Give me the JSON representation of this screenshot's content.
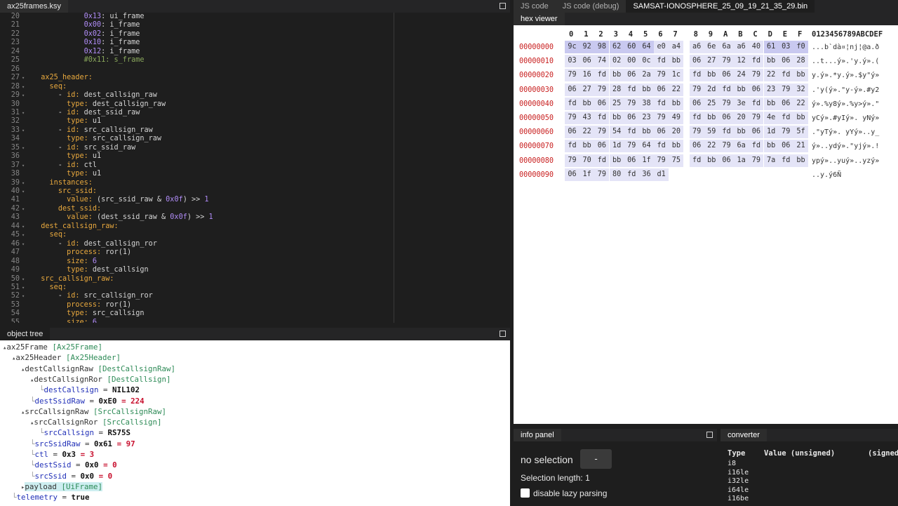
{
  "editor": {
    "tab": "ax25frames.ksy",
    "lines": [
      {
        "n": "20",
        "fold": false,
        "html": "            <span class='n'>0x13</span><span class='s'>: ui_frame</span>"
      },
      {
        "n": "21",
        "fold": false,
        "html": "            <span class='n'>0x00</span><span class='s'>: i_frame</span>"
      },
      {
        "n": "22",
        "fold": false,
        "html": "            <span class='n'>0x02</span><span class='s'>: i_frame</span>"
      },
      {
        "n": "23",
        "fold": false,
        "html": "            <span class='n'>0x10</span><span class='s'>: i_frame</span>"
      },
      {
        "n": "24",
        "fold": false,
        "html": "            <span class='n'>0x12</span><span class='s'>: i_frame</span>"
      },
      {
        "n": "25",
        "fold": false,
        "html": "            <span class='c'>#0x11: s_frame</span>"
      },
      {
        "n": "26",
        "fold": false,
        "html": ""
      },
      {
        "n": "27",
        "fold": true,
        "html": "  <span class='k'>ax25_header:</span>"
      },
      {
        "n": "28",
        "fold": true,
        "html": "    <span class='k'>seq:</span>"
      },
      {
        "n": "29",
        "fold": true,
        "html": "      - <span class='k'>id:</span> dest_callsign_raw"
      },
      {
        "n": "30",
        "fold": false,
        "html": "        <span class='k'>type:</span> dest_callsign_raw"
      },
      {
        "n": "31",
        "fold": true,
        "html": "      - <span class='k'>id:</span> dest_ssid_raw"
      },
      {
        "n": "32",
        "fold": false,
        "html": "        <span class='k'>type:</span> u1"
      },
      {
        "n": "33",
        "fold": true,
        "html": "      - <span class='k'>id:</span> src_callsign_raw"
      },
      {
        "n": "34",
        "fold": false,
        "html": "        <span class='k'>type:</span> src_callsign_raw"
      },
      {
        "n": "35",
        "fold": true,
        "html": "      - <span class='k'>id:</span> src_ssid_raw"
      },
      {
        "n": "36",
        "fold": false,
        "html": "        <span class='k'>type:</span> u1"
      },
      {
        "n": "37",
        "fold": true,
        "html": "      - <span class='k'>id:</span> ctl"
      },
      {
        "n": "38",
        "fold": false,
        "html": "        <span class='k'>type:</span> u1"
      },
      {
        "n": "39",
        "fold": true,
        "html": "    <span class='k'>instances:</span>"
      },
      {
        "n": "40",
        "fold": true,
        "html": "      <span class='k'>src_ssid:</span>"
      },
      {
        "n": "41",
        "fold": false,
        "html": "        <span class='k'>value:</span> (src_ssid_raw &amp; <span class='n'>0x0f</span>) &gt;&gt; <span class='n'>1</span>"
      },
      {
        "n": "42",
        "fold": true,
        "html": "      <span class='k'>dest_ssid:</span>"
      },
      {
        "n": "43",
        "fold": false,
        "html": "        <span class='k'>value:</span> (dest_ssid_raw &amp; <span class='n'>0x0f</span>) &gt;&gt; <span class='n'>1</span>"
      },
      {
        "n": "44",
        "fold": true,
        "html": "  <span class='k'>dest_callsign_raw:</span>"
      },
      {
        "n": "45",
        "fold": true,
        "html": "    <span class='k'>seq:</span>"
      },
      {
        "n": "46",
        "fold": true,
        "html": "      - <span class='k'>id:</span> dest_callsign_ror"
      },
      {
        "n": "47",
        "fold": false,
        "html": "        <span class='k'>process:</span> ror(1)"
      },
      {
        "n": "48",
        "fold": false,
        "html": "        <span class='k'>size:</span> <span class='n'>6</span>"
      },
      {
        "n": "49",
        "fold": false,
        "html": "        <span class='k'>type:</span> dest_callsign"
      },
      {
        "n": "50",
        "fold": true,
        "html": "  <span class='k'>src_callsign_raw:</span>"
      },
      {
        "n": "51",
        "fold": true,
        "html": "    <span class='k'>seq:</span>"
      },
      {
        "n": "52",
        "fold": true,
        "html": "      - <span class='k'>id:</span> src_callsign_ror"
      },
      {
        "n": "53",
        "fold": false,
        "html": "        <span class='k'>process:</span> ror(1)"
      },
      {
        "n": "54",
        "fold": false,
        "html": "        <span class='k'>type:</span> src_callsign"
      },
      {
        "n": "55",
        "fold": false,
        "html": "        <span class='k'>size:</span> <span class='n'>6</span>"
      }
    ]
  },
  "tree": {
    "title": "object tree",
    "nodes": [
      {
        "depth": 0,
        "name": "ax25Frame",
        "type": "[Ax25Frame]",
        "expander": "▴"
      },
      {
        "depth": 1,
        "name": "ax25Header",
        "type": "[Ax25Header]",
        "expander": "▴"
      },
      {
        "depth": 2,
        "name": "destCallsignRaw",
        "type": "[DestCallsignRaw]",
        "expander": "▴"
      },
      {
        "depth": 3,
        "name": "destCallsignRor",
        "type": "[DestCallsign]",
        "expander": "▴"
      },
      {
        "depth": 4,
        "field": "destCallsign",
        "value": "NIL102"
      },
      {
        "depth": 3,
        "field": "destSsidRaw",
        "value": "0xE0",
        "dec": "224"
      },
      {
        "depth": 2,
        "name": "srcCallsignRaw",
        "type": "[SrcCallsignRaw]",
        "expander": "▴"
      },
      {
        "depth": 3,
        "name": "srcCallsignRor",
        "type": "[SrcCallsign]",
        "expander": "▴"
      },
      {
        "depth": 4,
        "field": "srcCallsign",
        "value": "RS75S"
      },
      {
        "depth": 3,
        "field": "srcSsidRaw",
        "value": "0x61",
        "dec": "97"
      },
      {
        "depth": 3,
        "field": "ctl",
        "value": "0x3",
        "dec": "3"
      },
      {
        "depth": 3,
        "field": "destSsid",
        "value": "0x0",
        "dec": "0"
      },
      {
        "depth": 3,
        "field": "srcSsid",
        "value": "0x0",
        "dec": "0"
      },
      {
        "depth": 2,
        "name": "payload",
        "type": "[UiFrame]",
        "expander": "▸",
        "selected": true
      },
      {
        "depth": 1,
        "field": "telemetry",
        "value": "true"
      }
    ]
  },
  "right_tabs": [
    "JS code",
    "JS code (debug)",
    "SAMSAT-IONOSPHERE_25_09_19_21_35_29.bin"
  ],
  "hex": {
    "title": "hex viewer",
    "columns": [
      "0",
      "1",
      "2",
      "3",
      "4",
      "5",
      "6",
      "7",
      "8",
      "9",
      "A",
      "B",
      "C",
      "D",
      "E",
      "F"
    ],
    "ascii_header": "0123456789ABCDEF",
    "rows": [
      {
        "addr": "00000000",
        "bytes": [
          "9c",
          "92",
          "98",
          "62",
          "60",
          "64",
          "e0",
          "a4",
          "a6",
          "6e",
          "6a",
          "a6",
          "40",
          "61",
          "03",
          "f0"
        ],
        "ascii": "...b`dà¤¦nj¦@a.ð"
      },
      {
        "addr": "00000010",
        "bytes": [
          "03",
          "06",
          "74",
          "02",
          "00",
          "0c",
          "fd",
          "bb",
          "06",
          "27",
          "79",
          "12",
          "fd",
          "bb",
          "06",
          "28"
        ],
        "ascii": "..t...ý».'y.ý».("
      },
      {
        "addr": "00000020",
        "bytes": [
          "79",
          "16",
          "fd",
          "bb",
          "06",
          "2a",
          "79",
          "1c",
          "fd",
          "bb",
          "06",
          "24",
          "79",
          "22",
          "fd",
          "bb"
        ],
        "ascii": "y.ý».*y.ý».$y\"ý»"
      },
      {
        "addr": "00000030",
        "bytes": [
          "06",
          "27",
          "79",
          "28",
          "fd",
          "bb",
          "06",
          "22",
          "79",
          "2d",
          "fd",
          "bb",
          "06",
          "23",
          "79",
          "32"
        ],
        "ascii": ".'y(ý».\"y-ý».#y2"
      },
      {
        "addr": "00000040",
        "bytes": [
          "fd",
          "bb",
          "06",
          "25",
          "79",
          "38",
          "fd",
          "bb",
          "06",
          "25",
          "79",
          "3e",
          "fd",
          "bb",
          "06",
          "22"
        ],
        "ascii": "ý».%y8ý».%y>ý».\""
      },
      {
        "addr": "00000050",
        "bytes": [
          "79",
          "43",
          "fd",
          "bb",
          "06",
          "23",
          "79",
          "49",
          "fd",
          "bb",
          "06",
          "20",
          "79",
          "4e",
          "fd",
          "bb"
        ],
        "ascii": "yCý».#yIý». yNý»"
      },
      {
        "addr": "00000060",
        "bytes": [
          "06",
          "22",
          "79",
          "54",
          "fd",
          "bb",
          "06",
          "20",
          "79",
          "59",
          "fd",
          "bb",
          "06",
          "1d",
          "79",
          "5f"
        ],
        "ascii": ".\"yTý». yYý»..y_"
      },
      {
        "addr": "00000070",
        "bytes": [
          "fd",
          "bb",
          "06",
          "1d",
          "79",
          "64",
          "fd",
          "bb",
          "06",
          "22",
          "79",
          "6a",
          "fd",
          "bb",
          "06",
          "21"
        ],
        "ascii": "ý»..ydý».\"yjý».!"
      },
      {
        "addr": "00000080",
        "bytes": [
          "79",
          "70",
          "fd",
          "bb",
          "06",
          "1f",
          "79",
          "75",
          "fd",
          "bb",
          "06",
          "1a",
          "79",
          "7a",
          "fd",
          "bb"
        ],
        "ascii": "ypý»..yuý»..yzý»"
      },
      {
        "addr": "00000090",
        "bytes": [
          "06",
          "1f",
          "79",
          "80",
          "fd",
          "36",
          "d1"
        ],
        "ascii": "..y.ý6Ñ"
      }
    ],
    "highlight_bytes": [
      0,
      1,
      2,
      3,
      4,
      5,
      13,
      14,
      15
    ]
  },
  "info": {
    "title": "info panel",
    "selection": "no selection",
    "button": "-",
    "selection_length": "Selection length: 1",
    "lazy_label": "disable lazy parsing"
  },
  "converter": {
    "title": "converter",
    "headers": [
      "Type",
      "Value (unsigned)",
      "(signed"
    ],
    "types": [
      "i8",
      "i16le",
      "i32le",
      "i64le",
      "i16be"
    ]
  }
}
